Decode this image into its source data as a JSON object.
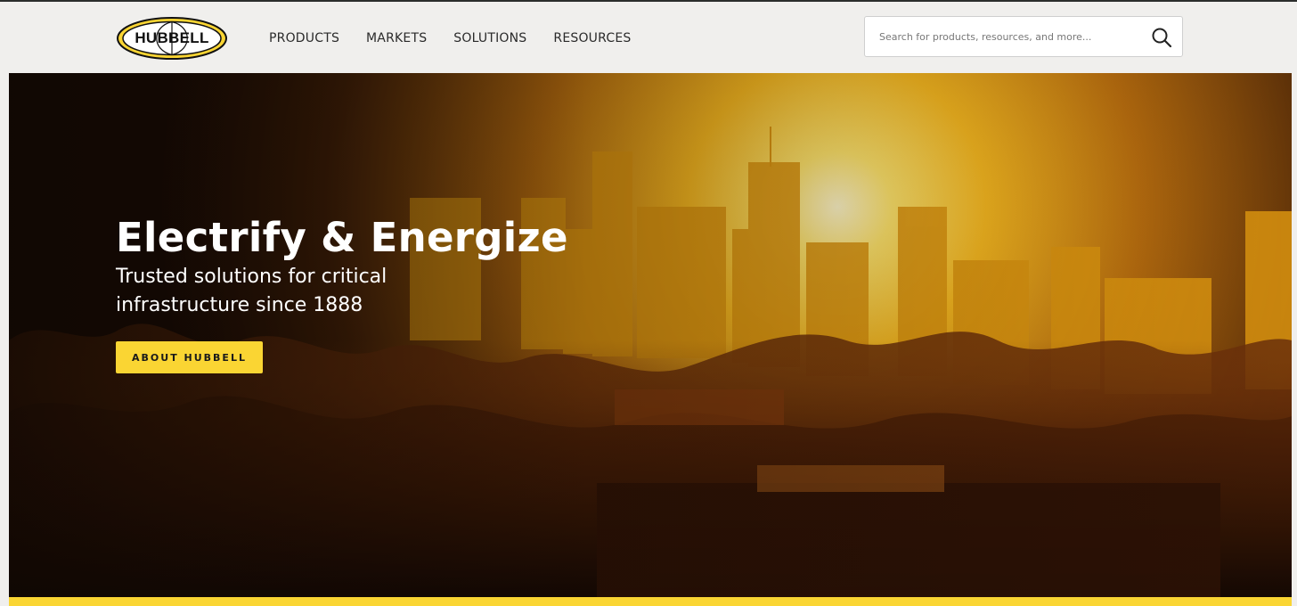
{
  "brand": {
    "logo_text": "HUBBELL",
    "colors": {
      "yellow": "#fad533",
      "dark": "#1a1a1a",
      "header_bg": "#f0efed"
    }
  },
  "nav": {
    "items": [
      {
        "label": "PRODUCTS"
      },
      {
        "label": "MARKETS"
      },
      {
        "label": "SOLUTIONS"
      },
      {
        "label": "RESOURCES"
      }
    ]
  },
  "search": {
    "placeholder": "Search for products, resources, and more...",
    "value": "",
    "icon": "search-icon"
  },
  "hero": {
    "title": "Electrify & Energize",
    "subtitle": "Trusted solutions for critical infrastructure since 1888",
    "cta_label": "ABOUT HUBBELL"
  }
}
